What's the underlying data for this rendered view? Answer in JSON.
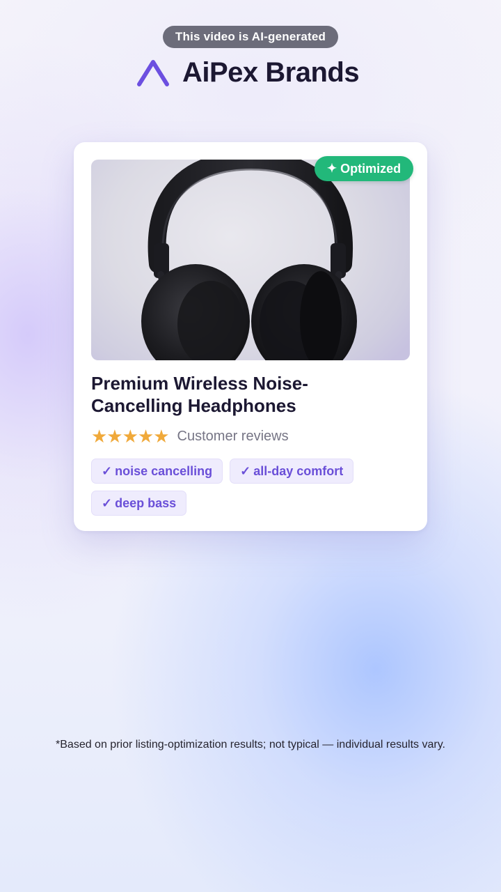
{
  "ai_label": "This video is AI-generated",
  "brand": {
    "name": "AiPex Brands",
    "logo_icon": "chevron-up-logo",
    "accent_color": "#6c4fe0"
  },
  "card": {
    "badge": {
      "icon": "sparkle-icon",
      "glyph": "✦",
      "label": "Optimized",
      "color": "#22b87a"
    },
    "image_subject": "headphones-icon",
    "title": "Premium Wireless Noise-Cancelling Headphones",
    "rating": {
      "stars": 5,
      "glyphs": "★★★★★",
      "label": "Customer reviews",
      "star_color": "#f0a93a"
    },
    "tags": [
      {
        "check": "✓",
        "label": "noise cancelling"
      },
      {
        "check": "✓",
        "label": "all-day comfort"
      },
      {
        "check": "✓",
        "label": "deep bass"
      }
    ]
  },
  "disclaimer": "*Based on prior listing-optimization results; not typical — individual results vary."
}
